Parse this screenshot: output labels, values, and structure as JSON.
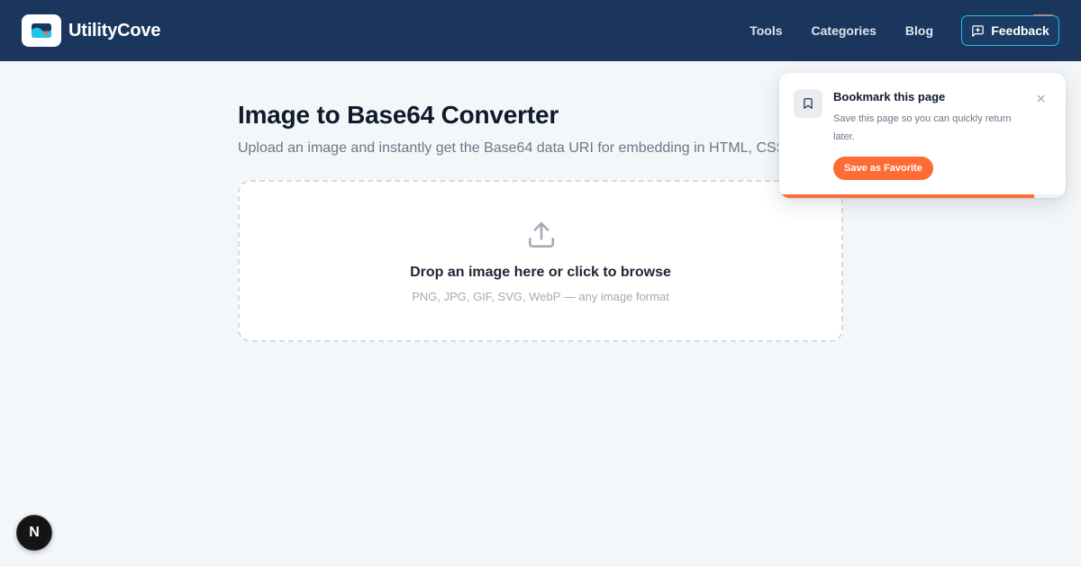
{
  "header": {
    "brand_name": "UtilityCove",
    "brand_logo_icon": "wave-logo-icon",
    "nav": [
      {
        "label": "Tools"
      },
      {
        "label": "Categories"
      },
      {
        "label": "Blog"
      }
    ],
    "feedback": {
      "label": "Feedback",
      "icon": "message-plus-icon"
    }
  },
  "main": {
    "title": "Image to Base64 Converter",
    "subtitle": "Upload an image and instantly get the Base64 data URI for embedding in HTML, CSS,",
    "dropzone": {
      "icon": "upload-icon",
      "title": "Drop an image here or click to browse",
      "hint": "PNG, JPG, GIF, SVG, WebP — any image format"
    }
  },
  "toast": {
    "icon": "bookmark-icon",
    "title": "Bookmark this page",
    "body": "Save this page so you can quickly return later.",
    "cta": "Save as Favorite",
    "close_icon": "close-icon",
    "progress": 0.89
  },
  "badge": {
    "label": "N"
  },
  "colors": {
    "navbar": "#1b365d",
    "accent_orange": "#ff6b35",
    "accent_cyan": "#22c3e6",
    "background": "#f4f7fa"
  }
}
